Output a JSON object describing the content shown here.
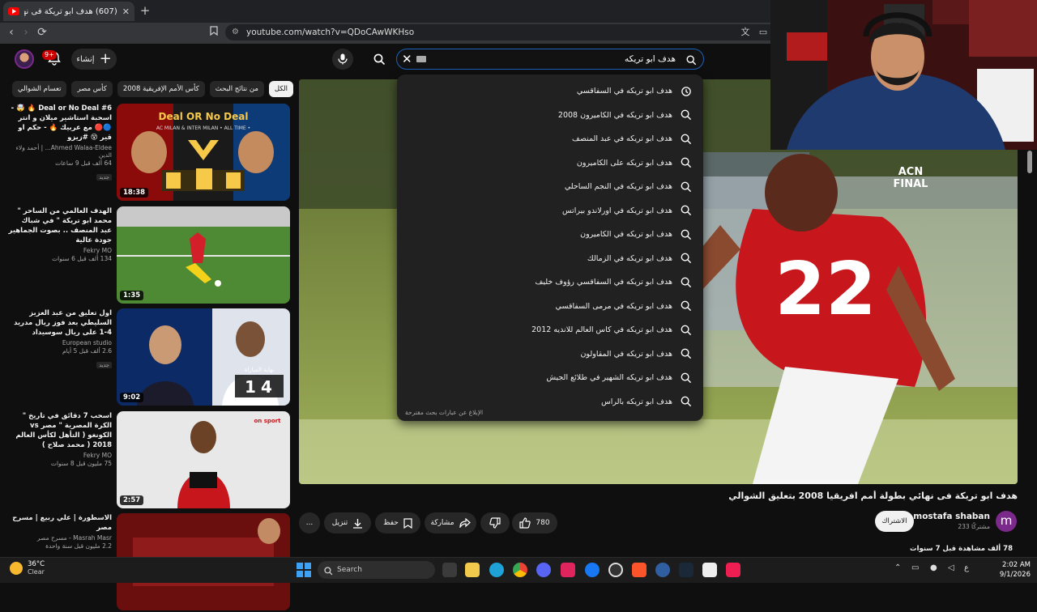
{
  "browser": {
    "tab_title": "(607) هدف ابو تريكة فى نهائي بط...",
    "new_tab": "+",
    "url": "youtube.com/watch?v=QDoCAwWKHso"
  },
  "header": {
    "notification_count": "9+",
    "create_label": "إنشاء",
    "search_value": "هدف ابو تريكه"
  },
  "suggestions": [
    {
      "text": "هدف ابو تريكه في السفاقسي",
      "icon": "history"
    },
    {
      "text": "هدف ابو تريكه في الكاميرون 2008",
      "icon": "search"
    },
    {
      "text": "هدف ابو تريكه في عبد المنصف",
      "icon": "search"
    },
    {
      "text": "هدف ابو تريكه على الكاميرون",
      "icon": "search"
    },
    {
      "text": "هدف ابو تريكه في النجم الساحلي",
      "icon": "search"
    },
    {
      "text": "هدف ابو تريكه في اورلاندو بيراتس",
      "icon": "search"
    },
    {
      "text": "هدف ابو تريكه في الكاميرون",
      "icon": "search"
    },
    {
      "text": "هدف ابو تريكه في الزمالك",
      "icon": "search"
    },
    {
      "text": "هدف ابو تريكه في السفاقسي رؤوف خليف",
      "icon": "search"
    },
    {
      "text": "هدف ابو تريكه في مرمى السفاقسي",
      "icon": "search"
    },
    {
      "text": "هدف ابو تريكه في كاس العالم للانديه 2012",
      "icon": "search"
    },
    {
      "text": "هدف ابو تريكه في المقاولون",
      "icon": "search"
    },
    {
      "text": "هدف ابو تريكه الشهير في طلائع الجيش",
      "icon": "search"
    },
    {
      "text": "هدف ابو تريكه بالراس",
      "icon": "search"
    }
  ],
  "suggestions_report": "الإبلاغ عن عبارات بحث مقترحة",
  "chips": [
    {
      "label": "الكل",
      "active": true
    },
    {
      "label": "من نتائج البحث",
      "active": false
    },
    {
      "label": "كأس الأمم الإفريقية 2008",
      "active": false
    },
    {
      "label": "كأس مصر",
      "active": false
    },
    {
      "label": "تعسام الشوالي",
      "active": false
    }
  ],
  "related": [
    {
      "title": "Deal or No Deal #6 🔥 🤯 - اسحبة استاشير ميلان و انتر 🔵🔴 مع عربيك 🔥 - حكم او قير 😵 #زيزو",
      "channel": "Ahmed Walaa-Eldee... | أحمد ولاء الدين",
      "meta": "64 ألف  قبل 9 ساعات",
      "badge": "جديد",
      "duration": "18:38"
    },
    {
      "title": "الهدف العالمي من الساحر \" محمد ابو تريكة \" في شباك عبد المنصف .. بصوت الجماهير جودة عالية",
      "channel": "Fekry MO",
      "meta": "134 ألف  قبل 6 سنوات",
      "badge": "",
      "duration": "1:35"
    },
    {
      "title": "اول تعليق من عبد العزيز السليطي بعد فوز ريال مدريد 4-1 على ريال سوسيداد",
      "channel": "European studio",
      "meta": "2.6 ألف  قبل 5 أيام",
      "badge": "جديد",
      "duration": "9:02"
    },
    {
      "title": "اسحب 7 دقائق في تاريخ \" الكرة المصرية \" مصر vs الكونغو ( التأهل لكأس العالم 2018 ( محمد صلاح )",
      "channel": "Fekry MO",
      "meta": "75 مليون  قبل 8 سنوات",
      "badge": "",
      "duration": "2:57"
    },
    {
      "title": "الاسطورة | علي ربيع | مسرح مصر",
      "channel": "Masrah Masr - مسرح مصر",
      "meta": "2.2 مليون  قبل سنة واحدة",
      "badge": "",
      "duration": ""
    }
  ],
  "thumb_texts": {
    "deal_title": "Deal OR No Deal",
    "deal_sub": "AC MILAN & INTER MILAN • ALL TIME •",
    "score_label": "نهاية المباراة",
    "score_home": "1",
    "score_away": "4",
    "acn_line1": "ACN",
    "acn_line2": "FINAL",
    "shirt_number": "22",
    "on_sport": "on sport"
  },
  "video": {
    "title": "هدف ابو تريكة فى نهائي بطولة أمم افريقيا 2008 بتعليق الشوالي",
    "channel_initial": "m",
    "channel": "mostafa shaban",
    "subscribers": "233 مشتركًا",
    "subscribe": "الاشتراك",
    "likes": "780",
    "share": "مشاركة",
    "save": "حفظ",
    "download": "تنزيل",
    "more": "...",
    "views": "78 ألف مشاهدة  قبل 7 سنوات"
  },
  "taskbar": {
    "temp": "36°C",
    "condition": "Clear",
    "search": "Search",
    "lang": "ع",
    "time": "2:02 AM",
    "date": "9/1/2026"
  },
  "colors": {
    "accent": "#1c62b9",
    "yt_red": "#ff0000",
    "ahly_red": "#c8161d"
  }
}
